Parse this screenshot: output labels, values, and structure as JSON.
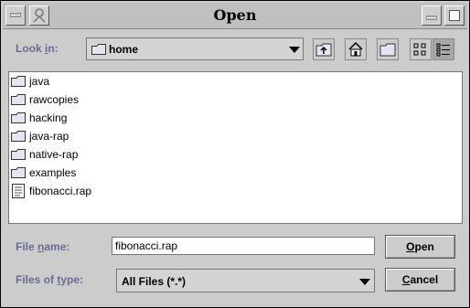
{
  "window": {
    "title": "Open"
  },
  "lookin": {
    "label_pre": "Look ",
    "label_u": "i",
    "label_post": "n:",
    "value": "home"
  },
  "files": [
    {
      "name": "java",
      "type": "folder"
    },
    {
      "name": "rawcopies",
      "type": "folder"
    },
    {
      "name": "hacking",
      "type": "folder"
    },
    {
      "name": "java-rap",
      "type": "folder"
    },
    {
      "name": "native-rap",
      "type": "folder"
    },
    {
      "name": "examples",
      "type": "folder"
    },
    {
      "name": "fibonacci.rap",
      "type": "file"
    }
  ],
  "filename": {
    "label_pre": "File ",
    "label_u": "n",
    "label_post": "ame:",
    "value": "fibonacci.rap"
  },
  "filetype": {
    "label_pre": "Files of ",
    "label_u": "t",
    "label_post": "ype:",
    "value": "All Files (*.*)"
  },
  "buttons": {
    "open_u": "O",
    "open_rest": "pen",
    "cancel_u": "C",
    "cancel_rest": "ancel"
  },
  "colors": {
    "label": "#6a6a94",
    "background": "#cccccc"
  }
}
